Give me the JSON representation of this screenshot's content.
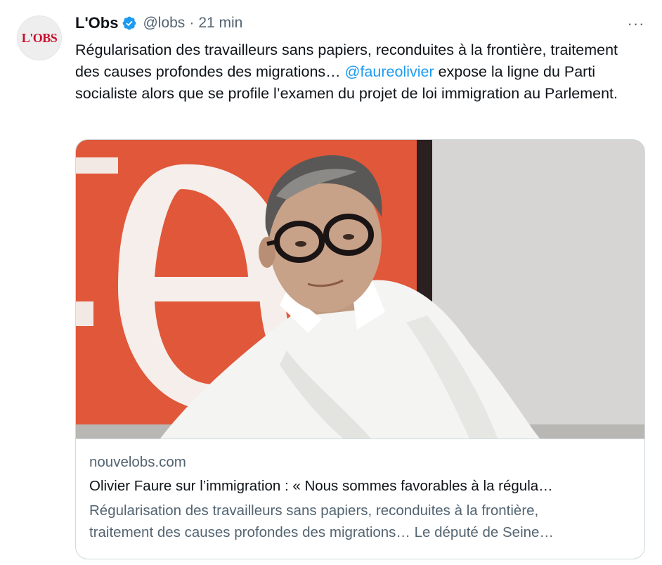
{
  "tweet": {
    "avatar_text": "L'OBS",
    "display_name": "L'Obs",
    "handle": "@lobs",
    "separator": "·",
    "time": "21 min",
    "more_label": "···",
    "text_before_mention": "Régularisation des travailleurs sans papiers, reconduites à la frontière, traitement des causes profondes des migrations… ",
    "mention": "@faureolivier",
    "text_after_mention": " expose la ligne du Parti socialiste alors que se profile l’examen du projet de loi immigration au Parlement."
  },
  "card": {
    "domain": "nouvelobs.com",
    "title": "Olivier Faure sur l’immigration : « Nous sommes favorables à la régula…",
    "description_line1": "Régularisation des travailleurs sans papiers, reconduites à la frontière,",
    "description_line2": "traitement des causes profondes des migrations… Le député de Seine…"
  },
  "colors": {
    "text": "#0f1419",
    "secondary": "#536471",
    "link": "#1d9bf0",
    "verified": "#1d9bf0",
    "avatar_red": "#c8102e",
    "banner_orange": "#e0573a"
  },
  "icons": {
    "verified": "verified-badge-icon",
    "more": "more-options-icon"
  }
}
